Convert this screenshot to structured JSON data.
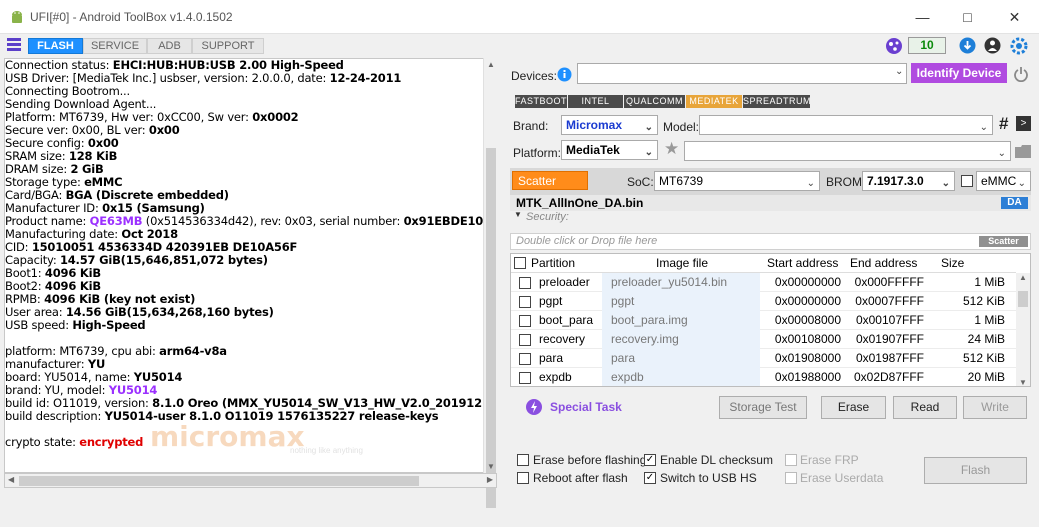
{
  "window": {
    "title": "UFI[#0] - Android ToolBox v1.4.0.1502"
  },
  "tabs": [
    "FLASH",
    "SERVICE",
    "ADB",
    "SUPPORT"
  ],
  "counter": "10",
  "log_lines": [
    [
      [
        "Connection status: ",
        ""
      ],
      [
        "EHCI:HUB:HUB:USB 2.00 High-Speed",
        "b"
      ]
    ],
    [
      [
        " USB Driver: ",
        ""
      ],
      [
        "[MediaTek Inc.] usbser",
        ""
      ],
      [
        ", version: ",
        ""
      ],
      [
        "2.0.0.0",
        ""
      ],
      [
        ", date: ",
        ""
      ],
      [
        "12-24-2011",
        "b"
      ]
    ],
    [
      [
        "Connecting Bootrom...",
        ""
      ]
    ],
    [
      [
        "Sending Download Agent...",
        ""
      ]
    ],
    [
      [
        "Platform: ",
        ""
      ],
      [
        "MT6739",
        ""
      ],
      [
        ", Hw ver: ",
        ""
      ],
      [
        "0xCC00",
        ""
      ],
      [
        ", Sw ver: ",
        ""
      ],
      [
        "0x0002",
        "b"
      ]
    ],
    [
      [
        " Secure ver: ",
        ""
      ],
      [
        "0x00",
        ""
      ],
      [
        ", BL ver: ",
        ""
      ],
      [
        "0x00",
        "b"
      ]
    ],
    [
      [
        " Secure config: ",
        ""
      ],
      [
        "0x00",
        "b"
      ]
    ],
    [
      [
        " SRAM size: ",
        ""
      ],
      [
        "128 KiB",
        "b"
      ]
    ],
    [
      [
        "DRAM size: ",
        ""
      ],
      [
        "2 GiB",
        "b"
      ]
    ],
    [
      [
        "Storage type: ",
        ""
      ],
      [
        "eMMC",
        "b"
      ]
    ],
    [
      [
        "Card/BGA: ",
        ""
      ],
      [
        "BGA (Discrete embedded)",
        "b"
      ]
    ],
    [
      [
        "Manufacturer ID: ",
        ""
      ],
      [
        "0x15 (Samsung)",
        "b"
      ]
    ],
    [
      [
        "Product name: ",
        ""
      ],
      [
        "QE63MB",
        "p"
      ],
      [
        " (0x514536334d42)",
        ""
      ],
      [
        ", rev: ",
        ""
      ],
      [
        "0x03",
        ""
      ],
      [
        ", serial number: ",
        ""
      ],
      [
        "0x91EBDE10",
        "b"
      ]
    ],
    [
      [
        "Manufacturing date: ",
        ""
      ],
      [
        "Oct 2018",
        "b"
      ]
    ],
    [
      [
        "CID: ",
        ""
      ],
      [
        "15010051 4536334D 420391EB DE10A56F",
        "b"
      ]
    ],
    [
      [
        "Capacity: ",
        ""
      ],
      [
        "14.57 GiB(15,646,851,072 bytes)",
        "b"
      ]
    ],
    [
      [
        " Boot1: ",
        ""
      ],
      [
        "4096 KiB",
        "b"
      ]
    ],
    [
      [
        " Boot2: ",
        ""
      ],
      [
        "4096 KiB",
        "b"
      ]
    ],
    [
      [
        " RPMB: ",
        ""
      ],
      [
        "4096 KiB (key not exist)",
        "b"
      ]
    ],
    [
      [
        " User area: ",
        ""
      ],
      [
        "14.56 GiB(15,634,268,160 bytes)",
        "b"
      ]
    ],
    [
      [
        "USB speed: ",
        ""
      ],
      [
        "High-Speed",
        "b"
      ]
    ],
    [
      [
        "",
        ""
      ]
    ],
    [
      [
        "platform: ",
        ""
      ],
      [
        "MT6739",
        ""
      ],
      [
        ", cpu abi: ",
        ""
      ],
      [
        "arm64-v8a",
        "b"
      ]
    ],
    [
      [
        "manufacturer: ",
        ""
      ],
      [
        "YU",
        "b"
      ]
    ],
    [
      [
        "board: ",
        ""
      ],
      [
        "YU5014",
        ""
      ],
      [
        ", name: ",
        ""
      ],
      [
        "YU5014",
        "b"
      ]
    ],
    [
      [
        "brand: ",
        ""
      ],
      [
        "YU",
        ""
      ],
      [
        ", model: ",
        ""
      ],
      [
        "YU5014",
        "p"
      ]
    ],
    [
      [
        "build id: ",
        ""
      ],
      [
        "O11019",
        ""
      ],
      [
        ", version: ",
        ""
      ],
      [
        "8.1.0 Oreo (MMX_YU5014_SW_V13_HW_V2.0_20191212)",
        "b"
      ]
    ],
    [
      [
        "build description: ",
        ""
      ],
      [
        "YU5014-user 8.1.0 O11019 1576135227 release-keys",
        "b"
      ]
    ],
    [
      [
        "",
        ""
      ]
    ],
    [
      [
        "crypto state: ",
        ""
      ],
      [
        "encrypted",
        "r"
      ]
    ]
  ],
  "watermark": {
    "brand": "micromax",
    "tagline": "nothing like anything"
  },
  "devices": {
    "label": "Devices:",
    "value": "",
    "identify_button": "Identify Device"
  },
  "platform_tabs": [
    "FASTBOOT",
    "INTEL",
    "QUALCOMM",
    "MEDIATEK",
    "SPREADTRUM"
  ],
  "brand": {
    "label": "Brand:",
    "value": "Micromax"
  },
  "model": {
    "label": "Model:",
    "value": ""
  },
  "platform": {
    "label": "Platform:",
    "value": "MediaTek"
  },
  "scatter": {
    "button": "Scatter",
    "soc_label": "SoC:",
    "soc_value": "MT6739",
    "brom_label": "BROM:",
    "brom_value": "7.1917.3.0",
    "storage": "eMMC"
  },
  "da": {
    "file": "MTK_AllInOne_DA.bin",
    "badge": "DA",
    "security": "Security:"
  },
  "scatter_file": {
    "placeholder": "Double click or Drop file here",
    "badge": "Scatter"
  },
  "table": {
    "headers": [
      "Partition",
      "Image file",
      "Start address",
      "End address",
      "Size"
    ],
    "rows": [
      [
        "preloader",
        "preloader_yu5014.bin",
        "0x00000000",
        "0x000FFFFF",
        "1 MiB"
      ],
      [
        "pgpt",
        "pgpt",
        "0x00000000",
        "0x0007FFFF",
        "512 KiB"
      ],
      [
        "boot_para",
        "boot_para.img",
        "0x00008000",
        "0x00107FFF",
        "1 MiB"
      ],
      [
        "recovery",
        "recovery.img",
        "0x00108000",
        "0x01907FFF",
        "24 MiB"
      ],
      [
        "para",
        "para",
        "0x01908000",
        "0x01987FFF",
        "512 KiB"
      ],
      [
        "expdb",
        "expdb",
        "0x01988000",
        "0x02D87FFF",
        "20 MiB"
      ]
    ]
  },
  "actions": {
    "special_task": "Special Task",
    "storage_test": "Storage Test",
    "erase": "Erase",
    "read": "Read",
    "write": "Write"
  },
  "options": {
    "erase_before": "Erase before flashing",
    "reboot_after": "Reboot after flash",
    "dl_checksum": "Enable DL checksum",
    "switch_usb": "Switch to USB HS",
    "erase_frp": "Erase FRP",
    "erase_userdata": "Erase Userdata",
    "flash": "Flash"
  }
}
